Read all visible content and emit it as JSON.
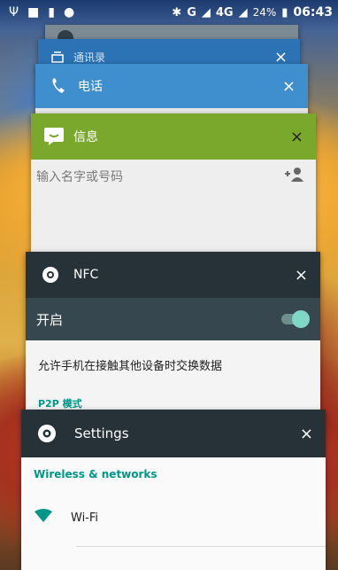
{
  "status_bar": {
    "left_icons": [
      "usb-icon",
      "lock-icon",
      "sd-card-icon",
      "android-icon"
    ],
    "network": "G",
    "network_lte": "4G",
    "battery": "24%",
    "time": "06:43"
  },
  "recent_apps": [
    {
      "name": "通讯录"
    },
    {
      "name": "电话"
    },
    {
      "name": "信息",
      "search_placeholder": "输入名字或号码"
    },
    {
      "name": "NFC",
      "toggle_label": "开启",
      "toggle_on": true,
      "description": "允许手机在接触其他设备时交换数据",
      "section": "P2P 模式"
    },
    {
      "name": "Settings",
      "section": "Wireless & networks",
      "wifi_label": "Wi-Fi"
    }
  ],
  "close_symbol": "×",
  "colors": {
    "phone_header": "#3f8ece",
    "messaging_header": "#79a82c",
    "settings_header": "#263238",
    "nfc_row": "#37474f",
    "accent_teal": "#009688"
  }
}
